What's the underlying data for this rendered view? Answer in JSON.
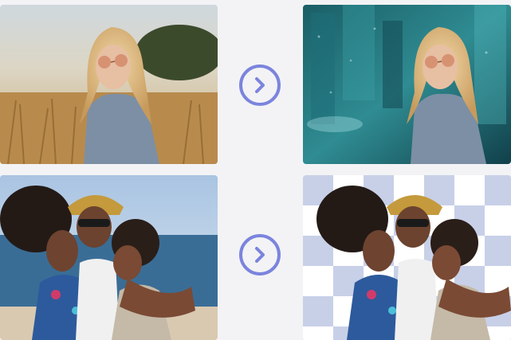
{
  "rows": [
    {
      "before": {
        "image": "woman-in-wheat-field-photo"
      },
      "action": {
        "icon": "chevron-right-icon"
      },
      "after": {
        "image": "woman-with-rainy-city-background-photo"
      }
    },
    {
      "before": {
        "image": "friends-at-beach-photo"
      },
      "action": {
        "icon": "chevron-right-icon"
      },
      "after": {
        "image": "friends-transparent-background-photo"
      }
    }
  ],
  "colors": {
    "page_background": "#f3f3f5",
    "accent": "#7b84dd",
    "checker_light": "#ffffff",
    "checker_dark": "#c8d0e8"
  }
}
